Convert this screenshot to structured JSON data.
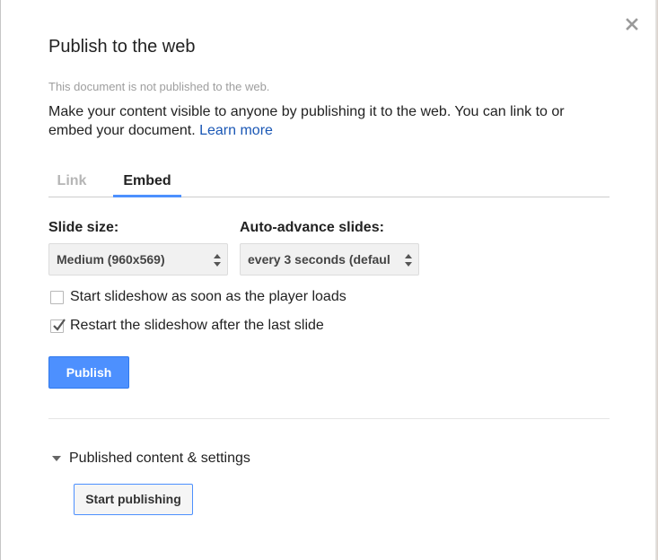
{
  "dialog": {
    "title": "Publish to the web",
    "status": "This document is not published to the web.",
    "description": "Make your content visible to anyone by publishing it to the web. You can link to or embed your document.",
    "learn_more": "Learn more",
    "close_icon": "close-icon"
  },
  "tabs": [
    {
      "label": "Link",
      "active": false
    },
    {
      "label": "Embed",
      "active": true
    }
  ],
  "embed": {
    "slide_size_label": "Slide size:",
    "slide_size_value": "Medium (960x569)",
    "auto_advance_label": "Auto-advance slides:",
    "auto_advance_value": "every 3 seconds (defaul",
    "start_on_load": {
      "label": "Start slideshow as soon as the player loads",
      "checked": false
    },
    "restart_after_last": {
      "label": "Restart the slideshow after the last slide",
      "checked": true
    },
    "publish_label": "Publish"
  },
  "published_section": {
    "label": "Published content & settings",
    "expanded": true,
    "start_publishing_label": "Start publishing"
  },
  "colors": {
    "accent": "#4d90fe",
    "link": "#1a57b5",
    "muted_text": "#9e9e9e"
  }
}
